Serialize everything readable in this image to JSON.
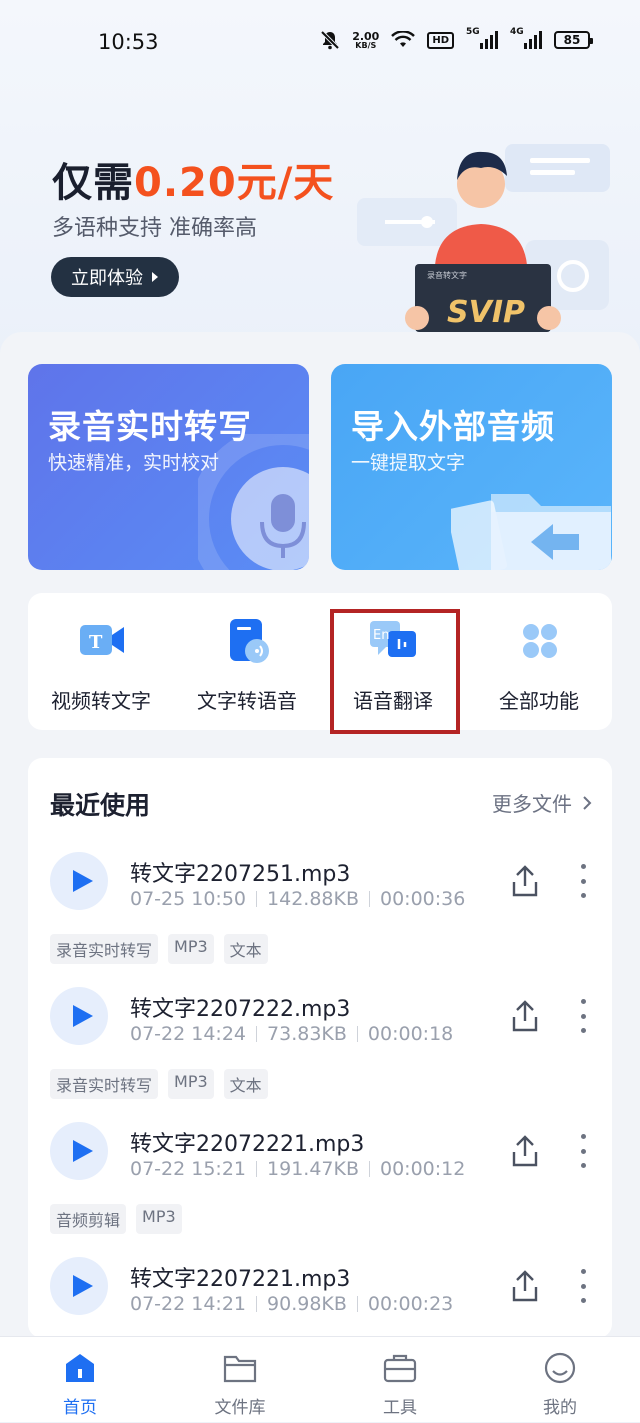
{
  "status": {
    "time": "10:53",
    "net_speed": "2.00",
    "net_unit": "KB/S",
    "hd": "HD",
    "sig1": "5G",
    "sig2": "4G",
    "battery": "85"
  },
  "promo": {
    "title_a": "仅需",
    "price": "0.20元/天",
    "subtitle": "多语种支持 准确率高",
    "button": "立即体验",
    "badge_small": "录音转文字",
    "badge_big": "SVIP"
  },
  "cards": [
    {
      "title": "录音实时转写",
      "subtitle": "快速精准，实时校对"
    },
    {
      "title": "导入外部音频",
      "subtitle": "一键提取文字"
    }
  ],
  "functions": [
    {
      "label": "视频转文字",
      "icon": "video-text-icon",
      "icon_text": "T"
    },
    {
      "label": "文字转语音",
      "icon": "text-speech-icon"
    },
    {
      "label": "语音翻译",
      "icon": "voice-translate-icon",
      "icon_text": "En"
    },
    {
      "label": "全部功能",
      "icon": "grid-icon"
    }
  ],
  "recent": {
    "title": "最近使用",
    "more": "更多文件",
    "items": [
      {
        "name": "转文字2207251.mp3",
        "date": "07-25 10:50",
        "size": "142.88KB",
        "duration": "00:00:36",
        "tags": [
          "录音实时转写",
          "MP3",
          "文本"
        ]
      },
      {
        "name": "转文字2207222.mp3",
        "date": "07-22 14:24",
        "size": "73.83KB",
        "duration": "00:00:18",
        "tags": [
          "录音实时转写",
          "MP3",
          "文本"
        ]
      },
      {
        "name": "转文字22072221.mp3",
        "date": "07-22 15:21",
        "size": "191.47KB",
        "duration": "00:00:12",
        "tags": [
          "音频剪辑",
          "MP3"
        ]
      },
      {
        "name": "转文字2207221.mp3",
        "date": "07-22 14:21",
        "size": "90.98KB",
        "duration": "00:00:23",
        "tags": []
      }
    ]
  },
  "nav": [
    {
      "label": "首页",
      "icon": "home-icon",
      "active": true
    },
    {
      "label": "文件库",
      "icon": "folder-icon",
      "active": false
    },
    {
      "label": "工具",
      "icon": "toolbox-icon",
      "active": false
    },
    {
      "label": "我的",
      "icon": "profile-icon",
      "active": false
    }
  ],
  "colors": {
    "accent": "#1e6ff2",
    "price": "#f4511e",
    "highlight": "#b42424"
  }
}
